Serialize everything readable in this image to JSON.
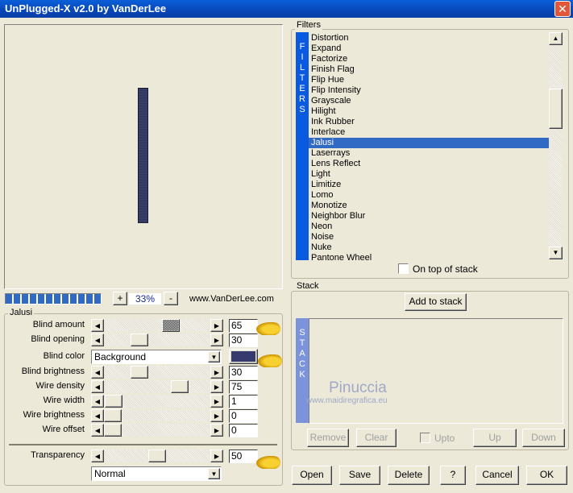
{
  "window": {
    "title": "UnPlugged-X v2.0 by VanDerLee",
    "close_icon": "close-icon"
  },
  "preview": {
    "zoom": "33%",
    "zoom_in": "+",
    "zoom_out": "-",
    "website": "www.VanDerLee.com",
    "strip_color": "#2e3358"
  },
  "filters": {
    "group_label": "Filters",
    "side_label": "FILTERS",
    "items": [
      "Distortion",
      "Expand",
      "Factorize",
      "Finish Flag",
      "Flip Hue",
      "Flip Intensity",
      "Grayscale",
      "Hilight",
      "Ink Rubber",
      "Interlace",
      "Jalusi",
      "Laserrays",
      "Lens Reflect",
      "Light",
      "Limitize",
      "Lomo",
      "Monotize",
      "Neighbor Blur",
      "Neon",
      "Noise",
      "Nuke",
      "Pantone Wheel"
    ],
    "selected": "Jalusi",
    "on_top_label": "On top of stack",
    "on_top_checked": false
  },
  "params": {
    "group_label": "Jalusi",
    "rows": [
      {
        "label": "Blind amount",
        "value": "65",
        "pos": 0.65
      },
      {
        "label": "Blind opening",
        "value": "30",
        "pos": 0.3
      },
      {
        "label": "Blind brightness",
        "value": "30",
        "pos": 0.3
      },
      {
        "label": "Wire density",
        "value": "75",
        "pos": 0.75
      },
      {
        "label": "Wire width",
        "value": "1",
        "pos": 0.01
      },
      {
        "label": "Wire brightness",
        "value": "0",
        "pos": 0
      },
      {
        "label": "Wire offset",
        "value": "0",
        "pos": 0
      }
    ],
    "blind_color": {
      "label": "Blind color",
      "value": "Background",
      "swatch": "#363a6e"
    },
    "transparency": {
      "label": "Transparency",
      "value": "50",
      "pos": 0.5
    },
    "blend_mode": "Normal"
  },
  "stack": {
    "group_label": "Stack",
    "side_label": "STACK",
    "add": "Add to stack",
    "remove": "Remove",
    "clear": "Clear",
    "upto": "Upto",
    "up": "Up",
    "down": "Down",
    "watermark": "Pinuccia",
    "watermark_url": "www.maidiregrafica.eu"
  },
  "footer": {
    "open": "Open",
    "save": "Save",
    "delete": "Delete",
    "help": "?",
    "cancel": "Cancel",
    "ok": "OK"
  }
}
